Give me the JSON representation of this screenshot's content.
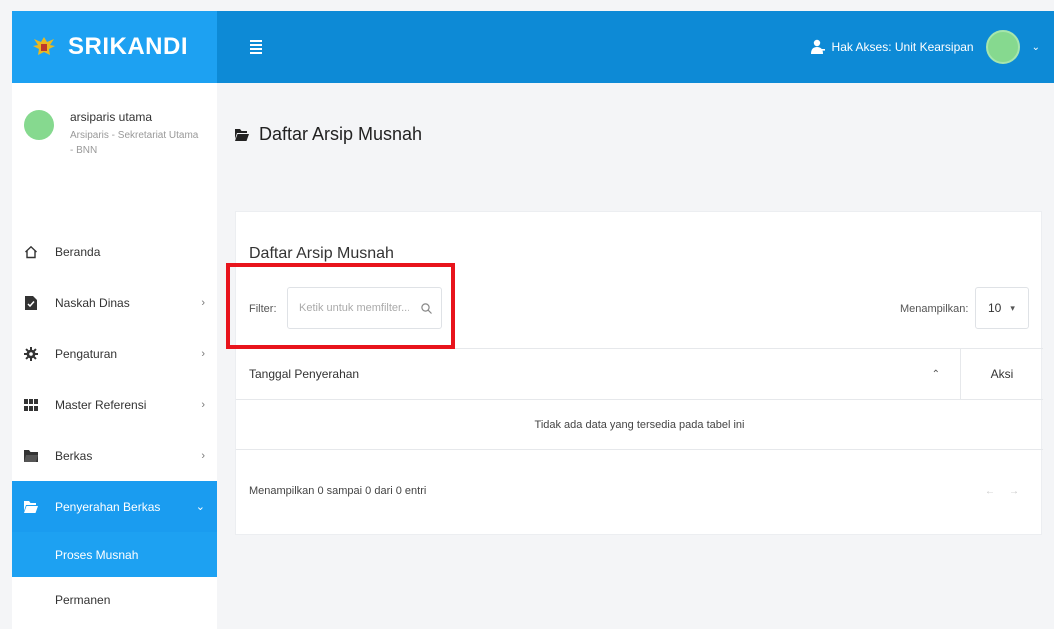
{
  "brand": {
    "name": "SRIKANDI"
  },
  "header": {
    "access_label": "Hak Akses: Unit Kearsipan",
    "caret": "⌄"
  },
  "profile": {
    "name": "arsiparis utama",
    "role": "Arsiparis - Sekretariat Utama - BNN"
  },
  "sidebar": {
    "items": [
      {
        "label": "Beranda",
        "icon": "home-icon",
        "chevron": ""
      },
      {
        "label": "Naskah Dinas",
        "icon": "document-check-icon",
        "chevron": "›"
      },
      {
        "label": "Pengaturan",
        "icon": "gear-icon",
        "chevron": "›"
      },
      {
        "label": "Master Referensi",
        "icon": "grid-icon",
        "chevron": "›"
      },
      {
        "label": "Berkas",
        "icon": "folder-icon",
        "chevron": "›"
      },
      {
        "label": "Penyerahan Berkas",
        "icon": "folder-open-icon",
        "chevron": "⌄"
      }
    ],
    "subitems": [
      {
        "label": "Proses Musnah"
      },
      {
        "label": "Permanen"
      }
    ]
  },
  "page": {
    "title": "Daftar Arsip Musnah"
  },
  "card": {
    "title": "Daftar Arsip Musnah",
    "filter_label": "Filter:",
    "filter_placeholder": "Ketik untuk memfilter...",
    "show_label": "Menampilkan:",
    "page_size": "10",
    "columns": {
      "date": "Tanggal Penyerahan",
      "action": "Aksi"
    },
    "empty_message": "Tidak ada data yang tersedia pada tabel ini",
    "info": "Menampilkan 0 sampai 0 dari 0 entri",
    "prev": "←",
    "next": "→"
  },
  "colors": {
    "brand": "#1da1f2",
    "topbar": "#0d8ad6",
    "active_menu": "#1a9cf0",
    "highlight": "#e8141c",
    "avatar": "#86d98f"
  }
}
